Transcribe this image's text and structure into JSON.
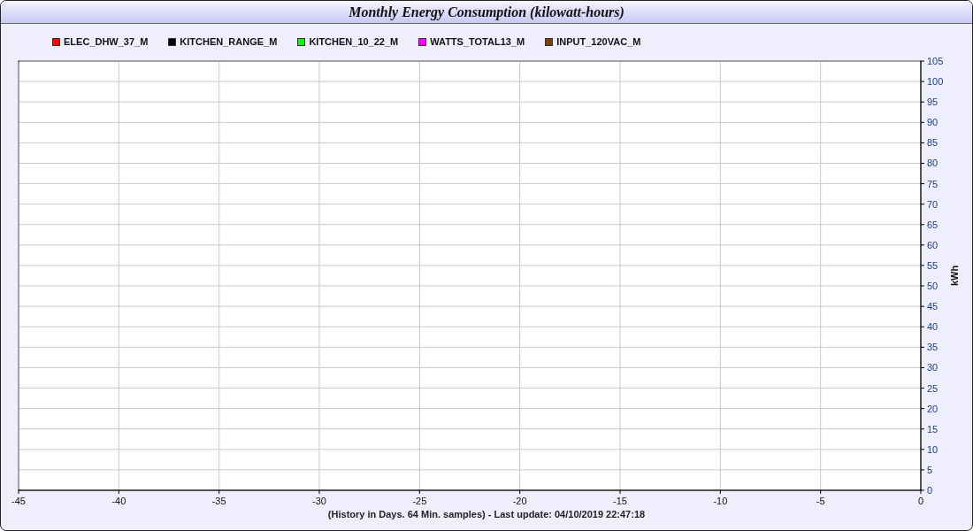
{
  "window": {
    "title": "Monthly Energy Consumption (kilowatt-hours)"
  },
  "legend": [
    {
      "label": "ELEC_DHW_37_M",
      "color": "#ff0000"
    },
    {
      "label": "KITCHEN_RANGE_M",
      "color": "#000000"
    },
    {
      "label": "KITCHEN_10_22_M",
      "color": "#00ff00"
    },
    {
      "label": "WATTS_TOTAL13_M",
      "color": "#ff00ff"
    },
    {
      "label": "INPUT_120VAC_M",
      "color": "#804000"
    }
  ],
  "chart": {
    "chart_data": {
      "type": "line",
      "grid": true,
      "ylabel": "kWh",
      "xlim": [
        -45,
        0
      ],
      "ylim": [
        0,
        105
      ],
      "xticks": [
        -45,
        -40,
        -35,
        -30,
        -25,
        -20,
        -15,
        -10,
        -5,
        0
      ],
      "yticks": [
        0,
        5,
        10,
        15,
        20,
        25,
        30,
        35,
        40,
        45,
        50,
        55,
        60,
        65,
        70,
        75,
        80,
        85,
        90,
        95,
        100,
        105
      ]
    }
  },
  "footer": "(History in Days. 64 Min. samples) - Last update: 04/10/2019 22:47:18"
}
